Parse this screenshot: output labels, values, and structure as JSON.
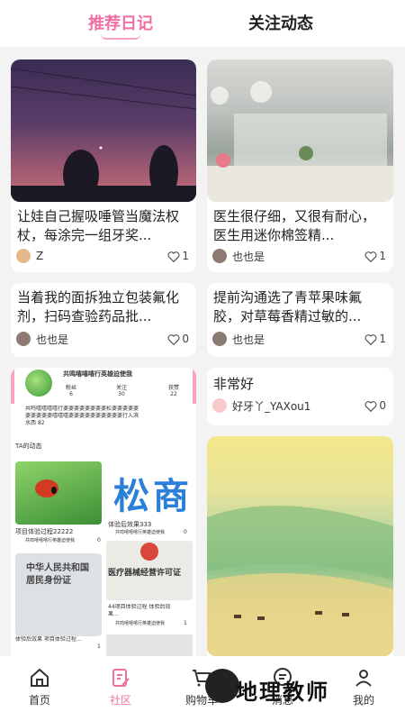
{
  "tabs": {
    "recommend": "推荐日记",
    "follow": "关注动态"
  },
  "posts": [
    {
      "title": "让娃自己握吸唾管当魔法权杖，每涂完一组牙奖...",
      "user": "Z",
      "likes": "1"
    },
    {
      "title": "医生很仔细，又很有耐心，医生用迷你棉签精...",
      "user": "也也是",
      "likes": "1"
    },
    {
      "title": "当着我的面拆独立包装氟化剂，扫码查验药品批...",
      "user": "也也是",
      "likes": "0"
    },
    {
      "title": "提前沟通选了青苹果味氟胶，对草莓香精过敏的...",
      "user": "也也是",
      "likes": "1"
    },
    {
      "title": "非常好",
      "user": "好牙丫_YAXou1",
      "likes": "0"
    }
  ],
  "profile_card": {
    "name": "共鸣嘻嘻嘻行英雄迫使我",
    "stats": [
      {
        "label": "粉丝",
        "value": "6"
      },
      {
        "label": "关注",
        "value": "30"
      },
      {
        "label": "获赞",
        "value": "22"
      }
    ],
    "desc": "共鸣嘻嘻嘻嘻行婆婆婆婆婆婆婆婆松婆婆婆婆婆婆婆婆婆婆嘻嘻嘻婆婆婆婆婆婆婆婆婆婆行入滨水西 82",
    "dynamic_label": "TA的动态",
    "items": [
      {
        "title": "项目体验过程22222",
        "user": "共鸣嘻嘻嘻行英雄迫使我",
        "likes": "0"
      },
      {
        "title": "体验后效果333",
        "user": "共鸣嘻嘻嘻行英雄迫使我",
        "likes": "0"
      },
      {
        "title": "体验后效果 项目体验过程...",
        "user": "",
        "likes": "1"
      },
      {
        "title": "44项目体验过程 体验后效果...",
        "user": "共鸣嘻嘻嘻行英雄迫使我",
        "likes": "1"
      }
    ],
    "id_text": "中华人民共和国 居民身份证",
    "license_text": "医疗器械经营许可证",
    "big_chars": "松商"
  },
  "nav": [
    {
      "label": "首页",
      "icon": "home-icon"
    },
    {
      "label": "社区",
      "icon": "community-icon"
    },
    {
      "label": "购物车",
      "icon": "cart-icon"
    },
    {
      "label": "消息",
      "icon": "message-icon"
    },
    {
      "label": "我的",
      "icon": "user-icon"
    }
  ],
  "watermark": "地理教师",
  "colors": {
    "accent": "#f06fa3",
    "background": "#f3f3f3"
  }
}
